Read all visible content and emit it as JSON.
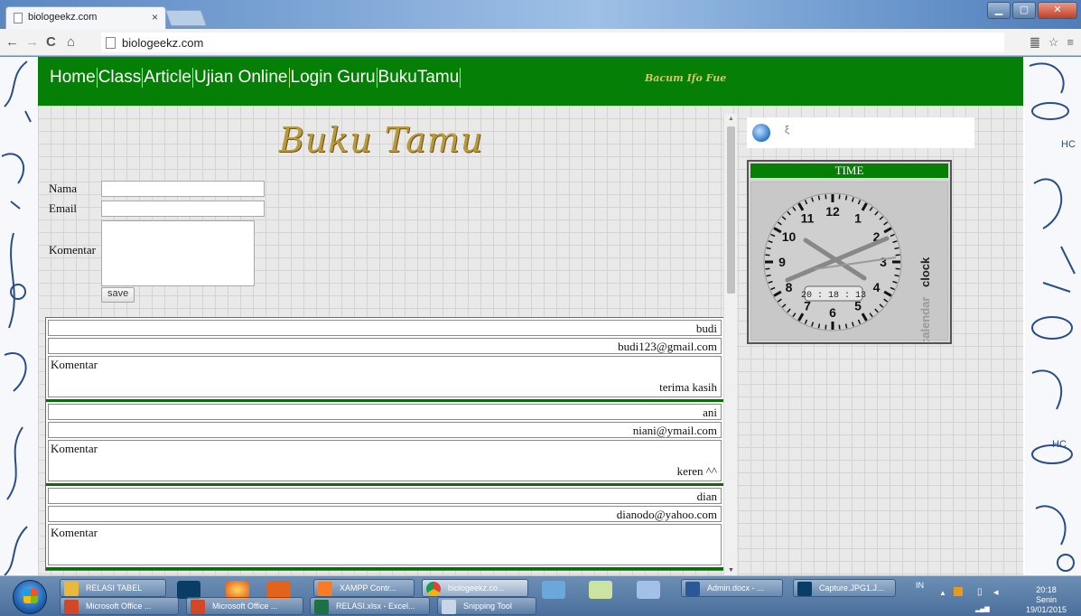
{
  "browser": {
    "tab_title": "biologeekz.com",
    "tab_close": "×",
    "url": "biologeekz.com",
    "back": "←",
    "forward": "→",
    "reload": "C",
    "home": "⌂",
    "star": "☆",
    "menu": "≡"
  },
  "site": {
    "nav": [
      "Home",
      "Class",
      "Article",
      "Ujian Online",
      "Login Guru",
      "BukuTamu"
    ],
    "marquee": "Bacum Ifo Fue"
  },
  "guestbook": {
    "title": "Buku Tamu",
    "labels": {
      "nama": "Nama",
      "email": "Email",
      "komentar": "Komentar"
    },
    "save_label": "save",
    "entries": [
      {
        "name": "budi",
        "email": "budi123@gmail.com",
        "komentar_label": "Komentar",
        "message": "terima kasih"
      },
      {
        "name": "ani",
        "email": "niani@ymail.com",
        "komentar_label": "Komentar",
        "message": "keren ^^"
      },
      {
        "name": "dian",
        "email": "dianodo@yahoo.com",
        "komentar_label": "Komentar",
        "message": ""
      }
    ]
  },
  "sidebar": {
    "widget_symbol": "ξ",
    "clock_title": "TIME",
    "clock_digital": "20 : 18 : 13",
    "clock_brand_a": "clock",
    "clock_brand_b": "calendar",
    "hour_numbers": [
      "12",
      "1",
      "2",
      "3",
      "4",
      "5",
      "6",
      "7",
      "8",
      "9",
      "10",
      "11"
    ]
  },
  "taskbar": {
    "row1": [
      "RELASI TABEL",
      "XAMPP Contr...",
      "biologeekz.co...",
      "Admin.docx - ...",
      "Capture.JPG1.J..."
    ],
    "row2": [
      "Microsoft Office ...",
      "Microsoft Office ...",
      "RELASI.xlsx - Excel...",
      "Snipping Tool"
    ],
    "lang": "IN",
    "time": "20:18",
    "day": "Senin",
    "date": "19/01/2015"
  },
  "colors": {
    "header_green": "#057f05",
    "title_gold": "#b89a3c"
  }
}
